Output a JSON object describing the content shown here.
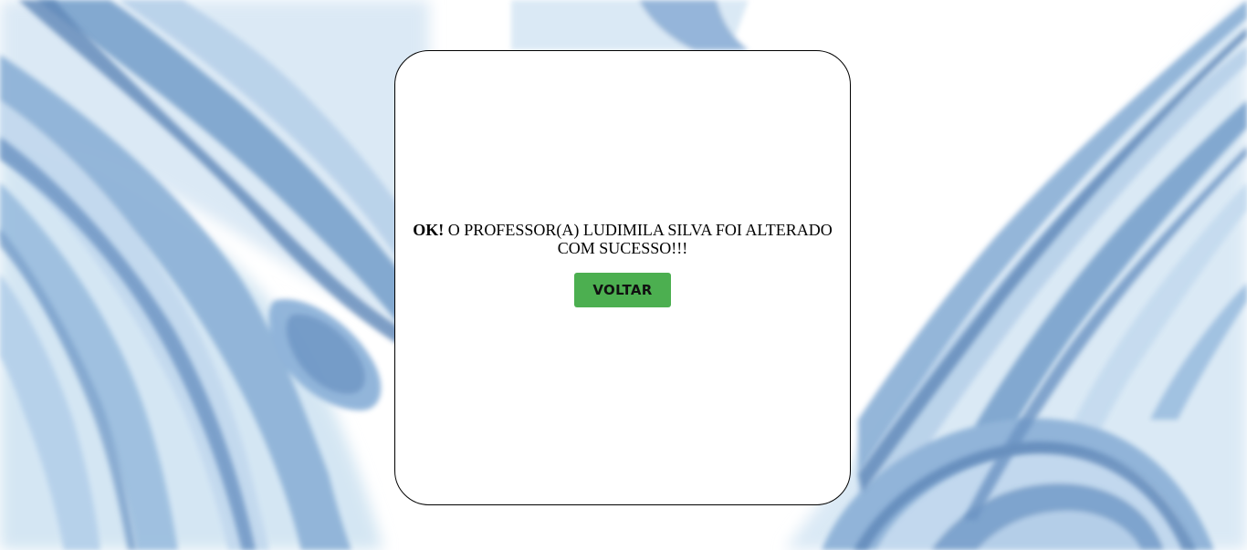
{
  "dialog": {
    "message_prefix": "OK!",
    "message_text": " O PROFESSOR(A) LUDIMILA SILVA FOI ALTERADO COM SUCESSO!!!",
    "back_button_label": "VOLTAR"
  },
  "colors": {
    "button_bg": "#4caf50",
    "button_text": "#111111",
    "card_border": "#000000",
    "watercolor_light": "#cfe2f1",
    "watercolor_mid": "#8fb6da",
    "watercolor_dark": "#5f87b8"
  }
}
